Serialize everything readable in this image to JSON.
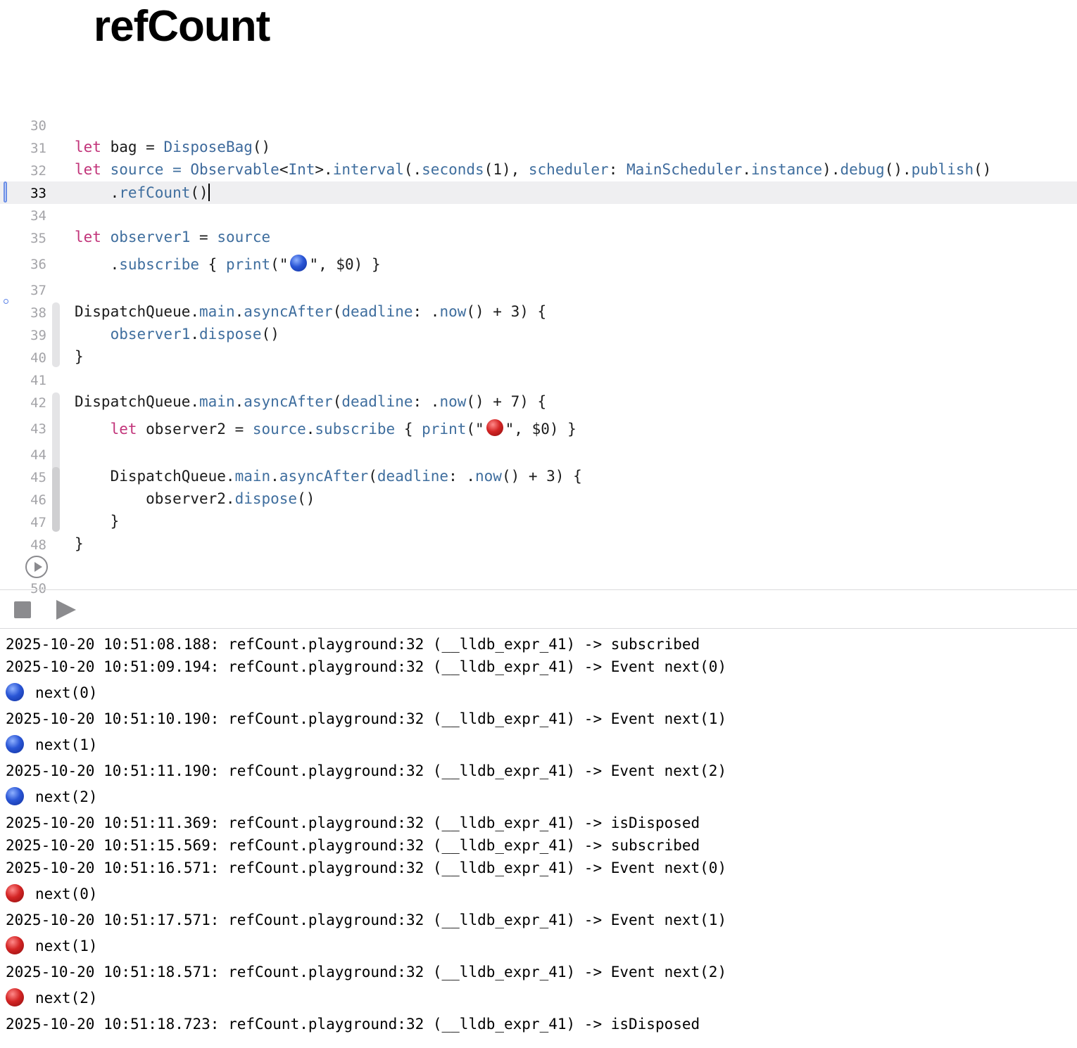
{
  "page_title": "refCount",
  "editor": {
    "current_line": 33,
    "lines": [
      {
        "n": "30"
      },
      {
        "n": "31"
      },
      {
        "n": "32"
      },
      {
        "n": "33"
      },
      {
        "n": "34"
      },
      {
        "n": "35"
      },
      {
        "n": "36"
      },
      {
        "n": "37"
      },
      {
        "n": "38"
      },
      {
        "n": "39"
      },
      {
        "n": "40"
      },
      {
        "n": "41"
      },
      {
        "n": "42"
      },
      {
        "n": "43"
      },
      {
        "n": "44"
      },
      {
        "n": "45"
      },
      {
        "n": "46"
      },
      {
        "n": "47"
      },
      {
        "n": "48"
      },
      {
        "n": "50"
      }
    ],
    "code": {
      "l31": {
        "kw": "let",
        "name": " bag = ",
        "type": "DisposeBag",
        "rest": "()"
      },
      "l32": {
        "kw": "let",
        "a": " source = ",
        "b": "Observable",
        "c": "<",
        "d": "Int",
        "e": ">.",
        "f": "interval",
        "g": "(.",
        "h": "seconds",
        "i": "(1), ",
        "j": "scheduler",
        "k": ": ",
        "l": "MainScheduler",
        "m": ".",
        "n": "instance",
        "o": ").",
        "p": "debug",
        "q": "().",
        "r": "publish",
        "s": "()"
      },
      "l33": {
        "a": "    .",
        "b": "refCount",
        "c": "()"
      },
      "l35": {
        "kw": "let",
        "a": " observer1",
        "b": " = ",
        "c": "source"
      },
      "l36": {
        "a": "    .",
        "b": "subscribe",
        "c": " { ",
        "d": "print",
        "e": "(\"",
        "f": "\", $0) }"
      },
      "l38": {
        "a": "DispatchQueue.",
        "b": "main",
        "c": ".",
        "d": "asyncAfter",
        "e": "(",
        "f": "deadline",
        "g": ": .",
        "h": "now",
        "i": "() + 3) {"
      },
      "l39": {
        "a": "    ",
        "b": "observer1",
        "c": ".",
        "d": "dispose",
        "e": "()"
      },
      "l40": {
        "a": "}"
      },
      "l42": {
        "a": "DispatchQueue.",
        "b": "main",
        "c": ".",
        "d": "asyncAfter",
        "e": "(",
        "f": "deadline",
        "g": ": .",
        "h": "now",
        "i": "() + 7) {"
      },
      "l43": {
        "a": "    ",
        "kw": "let",
        "b": " observer2 = ",
        "c": "source",
        "d": ".",
        "e": "subscribe",
        "f": " { ",
        "g": "print",
        "h": "(\"",
        "i": "\", $0) }"
      },
      "l45": {
        "a": "    DispatchQueue.",
        "b": "main",
        "c": ".",
        "d": "asyncAfter",
        "e": "(",
        "f": "deadline",
        "g": ": .",
        "h": "now",
        "i": "() + 3) {"
      },
      "l46": {
        "a": "        observer2.",
        "b": "dispose",
        "c": "()"
      },
      "l47": {
        "a": "    }"
      },
      "l48": {
        "a": "}"
      }
    }
  },
  "console": {
    "lines": [
      {
        "kind": "log",
        "text": "2025-10-20 10:51:08.188: refCount.playground:32 (__lldb_expr_41) -> subscribed"
      },
      {
        "kind": "log",
        "text": "2025-10-20 10:51:09.194: refCount.playground:32 (__lldb_expr_41) -> Event next(0)"
      },
      {
        "kind": "blue",
        "text": "next(0)"
      },
      {
        "kind": "log",
        "text": "2025-10-20 10:51:10.190: refCount.playground:32 (__lldb_expr_41) -> Event next(1)"
      },
      {
        "kind": "blue",
        "text": "next(1)"
      },
      {
        "kind": "log",
        "text": "2025-10-20 10:51:11.190: refCount.playground:32 (__lldb_expr_41) -> Event next(2)"
      },
      {
        "kind": "blue",
        "text": "next(2)"
      },
      {
        "kind": "log",
        "text": "2025-10-20 10:51:11.369: refCount.playground:32 (__lldb_expr_41) -> isDisposed"
      },
      {
        "kind": "log",
        "text": "2025-10-20 10:51:15.569: refCount.playground:32 (__lldb_expr_41) -> subscribed"
      },
      {
        "kind": "log",
        "text": "2025-10-20 10:51:16.571: refCount.playground:32 (__lldb_expr_41) -> Event next(0)"
      },
      {
        "kind": "red",
        "text": "next(0)"
      },
      {
        "kind": "log",
        "text": "2025-10-20 10:51:17.571: refCount.playground:32 (__lldb_expr_41) -> Event next(1)"
      },
      {
        "kind": "red",
        "text": "next(1)"
      },
      {
        "kind": "log",
        "text": "2025-10-20 10:51:18.571: refCount.playground:32 (__lldb_expr_41) -> Event next(2)"
      },
      {
        "kind": "red",
        "text": "next(2)"
      },
      {
        "kind": "log",
        "text": "2025-10-20 10:51:18.723: refCount.playground:32 (__lldb_expr_41) -> isDisposed"
      }
    ]
  },
  "colors": {
    "keyword": "#c2347a",
    "type": "#3e6a9c",
    "caret_marker": "#6c8fe6",
    "current_line_bg": "#efeff1"
  },
  "icons": {
    "stop": "stop-icon",
    "run": "play-icon",
    "run_line": "run-line-icon",
    "blue_circle": "blue-circle-emoji",
    "red_circle": "red-circle-emoji"
  }
}
